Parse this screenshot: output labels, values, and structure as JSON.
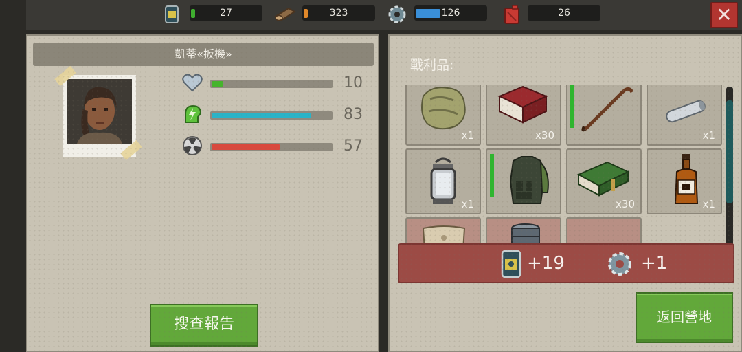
{
  "resources": [
    {
      "name": "canned-food",
      "value": "27",
      "level": 0.05,
      "color": "#3fae2f"
    },
    {
      "name": "wood",
      "value": "323",
      "level": 0.05,
      "color": "#e0882a"
    },
    {
      "name": "parts",
      "value": "126",
      "level": 0.35,
      "color": "#3a8fd8"
    },
    {
      "name": "fuel",
      "value": "26",
      "level": 0,
      "color": "#cc2f2f"
    }
  ],
  "close_label": "✕",
  "character": {
    "name": "凱蒂«扳機»",
    "stats": [
      {
        "name": "health",
        "value": "10",
        "level": 0.1,
        "color": "#45b52c"
      },
      {
        "name": "energy",
        "value": "83",
        "level": 0.83,
        "color": "#2ab3c7"
      },
      {
        "name": "radiation",
        "value": "57",
        "level": 0.57,
        "color": "#d9493e"
      }
    ]
  },
  "search_report_label": "搜查報告",
  "loot": {
    "title": "戰利品:",
    "items": [
      {
        "name": "cloth",
        "qty": "x1"
      },
      {
        "name": "book",
        "qty": "x30"
      },
      {
        "name": "crowbar",
        "qty": ""
      },
      {
        "name": "pipe",
        "qty": "x1"
      },
      {
        "name": "lantern",
        "qty": "x1"
      },
      {
        "name": "armor-vest",
        "qty": ""
      },
      {
        "name": "ammo-box",
        "qty": "x30"
      },
      {
        "name": "whiskey",
        "qty": "x1"
      },
      {
        "name": "sack",
        "qty": ""
      },
      {
        "name": "barrel",
        "qty": ""
      },
      {
        "name": "empty-red",
        "qty": ""
      }
    ]
  },
  "rewards": [
    {
      "name": "canned-food",
      "value": "+19"
    },
    {
      "name": "parts",
      "value": "+1"
    }
  ],
  "return_camp_label": "返回營地"
}
